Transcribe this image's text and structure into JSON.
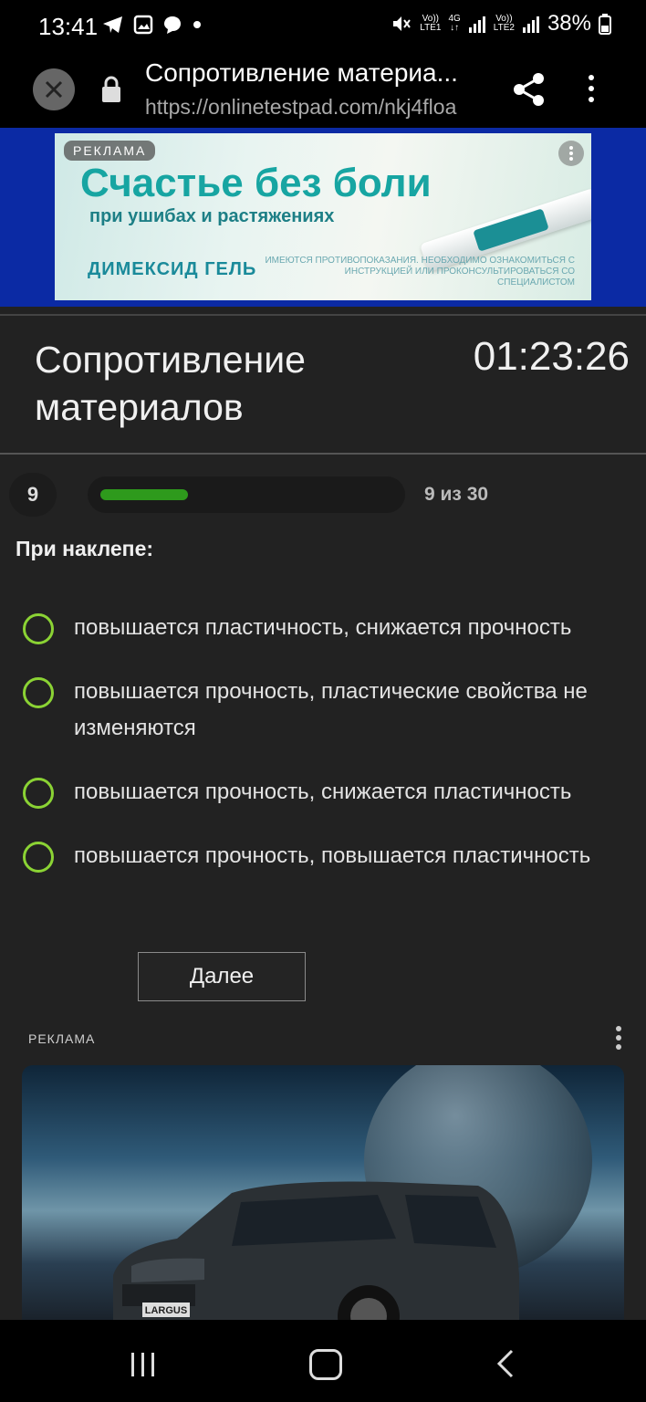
{
  "status_bar": {
    "time": "13:41",
    "battery": "38%",
    "sim1_top": "Vo))",
    "sim1_bottom": "LTE1",
    "net_top": "4G",
    "sim2_top": "Vo))",
    "sim2_bottom": "LTE2"
  },
  "browser": {
    "title": "Сопротивление материа...",
    "url": "https://onlinetestpad.com/nkj4floa"
  },
  "ad_top": {
    "badge": "РЕКЛАМА",
    "headline": "Счастье без боли",
    "subline": "при ушибах и растяжениях",
    "brand": "ДИМЕКСИД ГЕЛЬ",
    "disclaimer": "ИМЕЮТСЯ ПРОТИВОПОКАЗАНИЯ. НЕОБХОДИМО ОЗНАКОМИТЬСЯ С ИНСТРУКЦИЕЙ ИЛИ ПРОКОНСУЛЬТИРОВАТЬСЯ СО СПЕЦИАЛИСТОМ"
  },
  "test": {
    "title": "Сопротивление материалов",
    "timer": "01:23:26",
    "question_number": "9",
    "progress_label": "9 из 30",
    "progress_fraction": 0.3,
    "question": "При наклепе:",
    "answers": [
      "повышается пластичность, снижается прочность",
      "повышается прочность, пластические свойства не изменяются",
      "повышается прочность, снижается пластичность",
      "повышается прочность, повышается пластичность"
    ],
    "next_label": "Далее"
  },
  "ad_bottom": {
    "label": "РЕКЛАМА",
    "car_badge": "LARGUS"
  },
  "colors": {
    "accent_green": "#8bd334",
    "progress_green": "#2e9a1c",
    "ad_blue": "#0b2aa4"
  },
  "icons": [
    "close-icon",
    "lock-icon",
    "share-icon",
    "more-vert-icon",
    "telegram-icon",
    "gallery-icon",
    "chat-icon",
    "mute-icon",
    "signal-icon",
    "battery-icon",
    "recent-apps-icon",
    "home-icon",
    "back-icon"
  ]
}
